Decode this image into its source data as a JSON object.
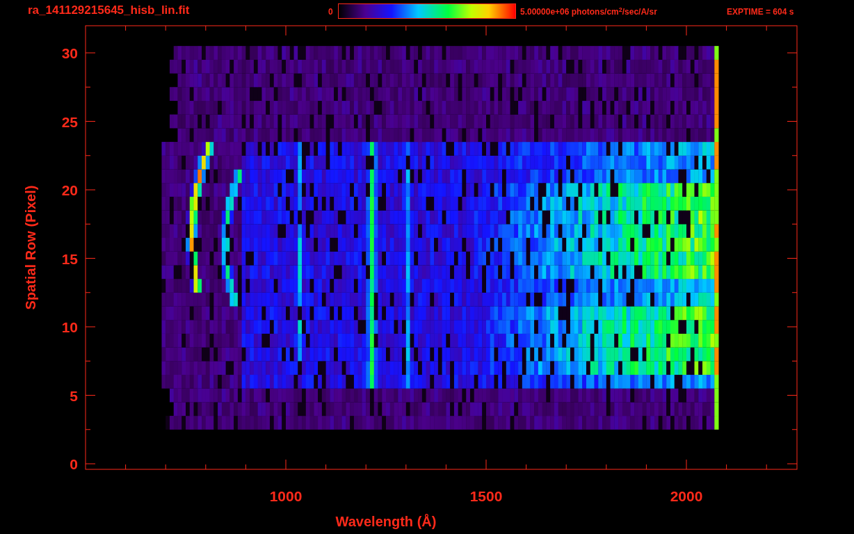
{
  "header": {
    "title": "ra_141129215645_hisb_lin.fit",
    "colorbar": {
      "min_label": "0",
      "max_label": "5.00000e+06 photons/cm$^{2}$/sec/A/sr"
    },
    "exptime": "EXPTIME = 604 s"
  },
  "plot": {
    "y_axis": {
      "label": "Spatial Row (Pixel)",
      "ticks": [
        "30",
        "25",
        "20",
        "15",
        "10",
        "5",
        "0"
      ]
    },
    "x_axis": {
      "label": "Wavelength (Å)",
      "ticks": [
        "1000",
        "1500",
        "2000"
      ]
    }
  }
}
